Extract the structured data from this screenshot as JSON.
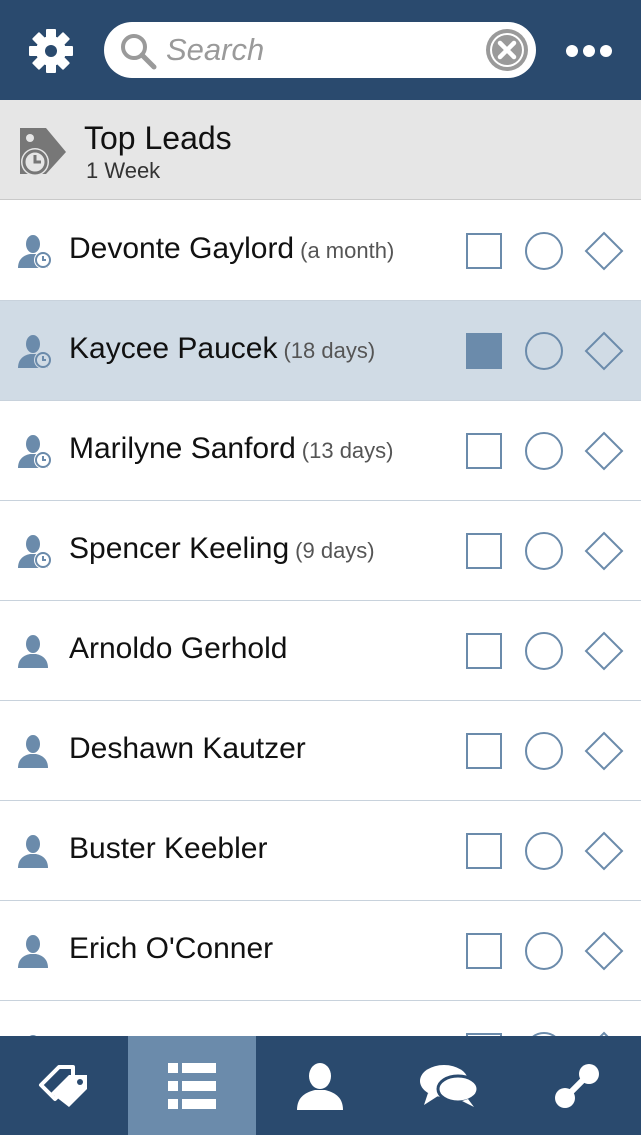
{
  "colors": {
    "topbar": "#2a4a6e",
    "accent": "#6b8bab",
    "selected_row": "#d0dbe5",
    "header_bg": "#e6e6e6"
  },
  "toolbar": {
    "settings_icon": "gear-icon",
    "search_placeholder": "Search",
    "search_value": "",
    "clear_icon": "close-circle-icon",
    "more_icon": "more-dots-icon"
  },
  "filter": {
    "icon": "tag-clock-icon",
    "title": "Top Leads",
    "subtitle": "1 Week"
  },
  "leads": [
    {
      "name": "Devonte Gaylord",
      "age": "(a month)",
      "icon": "person-clock-icon",
      "checked": false,
      "selected": false
    },
    {
      "name": "Kaycee Paucek",
      "age": "(18 days)",
      "icon": "person-clock-icon",
      "checked": true,
      "selected": true
    },
    {
      "name": "Marilyne Sanford",
      "age": "(13 days)",
      "icon": "person-clock-icon",
      "checked": false,
      "selected": false
    },
    {
      "name": "Spencer Keeling",
      "age": "(9 days)",
      "icon": "person-clock-icon",
      "checked": false,
      "selected": false
    },
    {
      "name": "Arnoldo Gerhold",
      "age": "",
      "icon": "person-icon",
      "checked": false,
      "selected": false
    },
    {
      "name": "Deshawn Kautzer",
      "age": "",
      "icon": "person-icon",
      "checked": false,
      "selected": false
    },
    {
      "name": "Buster Keebler",
      "age": "",
      "icon": "person-icon",
      "checked": false,
      "selected": false
    },
    {
      "name": "Erich O'Conner",
      "age": "",
      "icon": "person-icon",
      "checked": false,
      "selected": false
    },
    {
      "name": "",
      "age": "",
      "icon": "person-icon",
      "checked": false,
      "selected": false
    }
  ],
  "tabs": [
    {
      "icon": "tags-icon",
      "active": false
    },
    {
      "icon": "list-icon",
      "active": true
    },
    {
      "icon": "contact-icon",
      "active": false
    },
    {
      "icon": "chat-icon",
      "active": false
    },
    {
      "icon": "connect-icon",
      "active": false
    }
  ]
}
